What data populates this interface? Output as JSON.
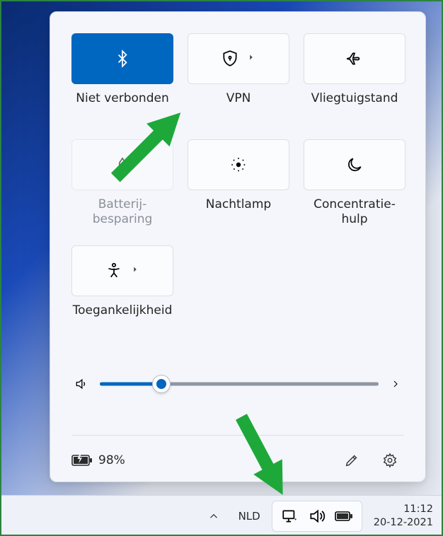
{
  "tiles": [
    {
      "id": "bluetooth",
      "label": "Niet verbonden",
      "active": true,
      "chevron": true
    },
    {
      "id": "vpn",
      "label": "VPN",
      "chevron": true
    },
    {
      "id": "airplane",
      "label": "Vliegtuigstand"
    },
    {
      "id": "battery-saver",
      "label": "Batterij-\nbesparing",
      "disabled": true
    },
    {
      "id": "nightlight",
      "label": "Nachtlamp"
    },
    {
      "id": "focus",
      "label": "Concentratie-\nhulp"
    },
    {
      "id": "accessibility",
      "label": "Toegankelijkheid",
      "chevron": true
    }
  ],
  "volume": {
    "percent": 22
  },
  "battery": {
    "text": "98%"
  },
  "taskbar": {
    "lang": "NLD",
    "time": "11:12",
    "date": "20-12-2021"
  }
}
